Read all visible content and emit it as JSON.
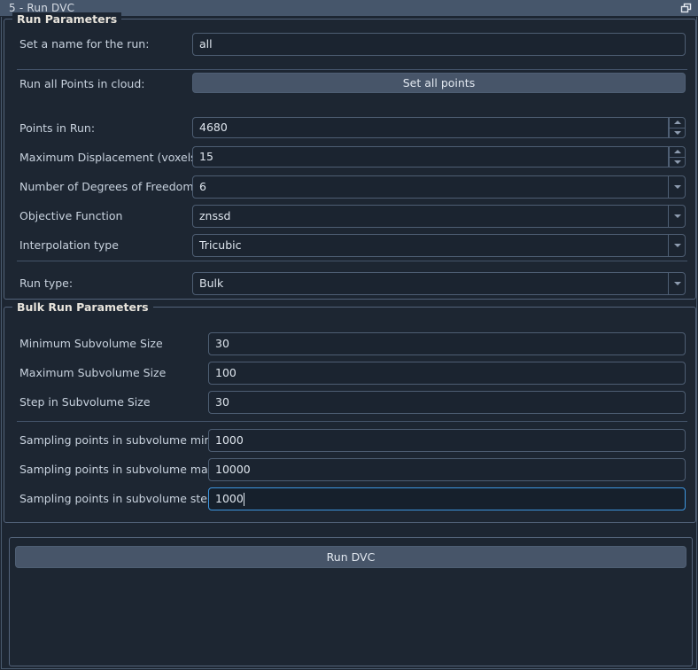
{
  "window": {
    "title": "5 - Run DVC",
    "float_button_icon": "float-restore-icon"
  },
  "run_parameters": {
    "group_title": "Run Parameters",
    "fields": [
      {
        "label": "Set a name for the run:",
        "value": "all",
        "control": "text"
      },
      {
        "label": "Run all Points in cloud:",
        "value": "Set all points",
        "control": "button"
      },
      {
        "label": "Points in Run:",
        "value": "4680",
        "control": "spinbox"
      },
      {
        "label": "Maximum Displacement (voxels)",
        "value": "15",
        "control": "spinbox"
      },
      {
        "label": "Number of Degrees of Freedom",
        "value": "6",
        "control": "combobox"
      },
      {
        "label": "Objective Function",
        "value": "znssd",
        "control": "combobox"
      },
      {
        "label": "Interpolation type",
        "value": "Tricubic",
        "control": "combobox"
      },
      {
        "label": "Run type:",
        "value": "Bulk",
        "control": "combobox"
      }
    ]
  },
  "bulk_run_parameters": {
    "group_title": "Bulk Run Parameters",
    "fields": [
      {
        "label": "Minimum Subvolume Size",
        "value": "30",
        "control": "text"
      },
      {
        "label": "Maximum Subvolume Size",
        "value": "100",
        "control": "text"
      },
      {
        "label": "Step in Subvolume Size",
        "value": "30",
        "control": "text"
      },
      {
        "label": "Sampling points in subvolume min",
        "value": "1000",
        "control": "text"
      },
      {
        "label": "Sampling points in subvolume max",
        "value": "10000",
        "control": "text"
      },
      {
        "label": "Sampling points in subvolume step",
        "value": "1000",
        "control": "text",
        "focused": true
      }
    ]
  },
  "actions": {
    "run_dvc_label": "Run DVC"
  },
  "colors": {
    "window_background": "#1d2632",
    "titlebar_background": "#46566b",
    "accent_focus": "#3d96e0",
    "button_face": "#475569",
    "border": "#4e5e73",
    "label_text": "#c8d2de",
    "group_title_text": "#e8e4dc"
  }
}
